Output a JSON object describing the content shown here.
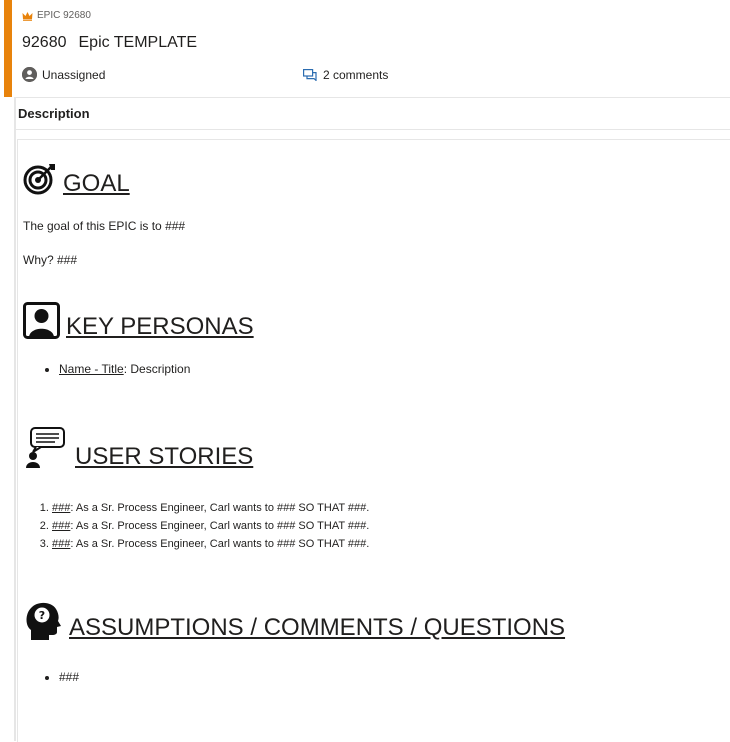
{
  "work_item": {
    "type_label": "EPIC 92680",
    "id": "92680",
    "title": "Epic TEMPLATE",
    "assignee": "Unassigned",
    "comments_label": "2 comments",
    "accent_color": "#e8830c"
  },
  "description_header": "Description",
  "description": {
    "goal": {
      "heading": "GOAL",
      "icon": "target-icon",
      "line1": "The goal of this EPIC is to ###",
      "line2": "Why? ###"
    },
    "personas": {
      "heading": "KEY PERSONAS",
      "icon": "person-portrait-icon",
      "items": [
        {
          "link": "Name - Title",
          "rest": ": Description"
        }
      ]
    },
    "stories": {
      "heading": "USER STORIES",
      "icon": "speaking-person-icon",
      "items": [
        {
          "link": "###",
          "rest": ": As a Sr. Process Engineer, Carl wants to ### SO THAT ###."
        },
        {
          "link": "###",
          "rest": ": As a Sr. Process Engineer, Carl wants to ### SO THAT ###."
        },
        {
          "link": "###",
          "rest": ": As a Sr. Process Engineer, Carl wants to ### SO THAT ###."
        }
      ]
    },
    "assumptions": {
      "heading": "ASSUMPTIONS / COMMENTS / QUESTIONS",
      "icon": "head-question-icon",
      "items": [
        "###"
      ]
    }
  }
}
